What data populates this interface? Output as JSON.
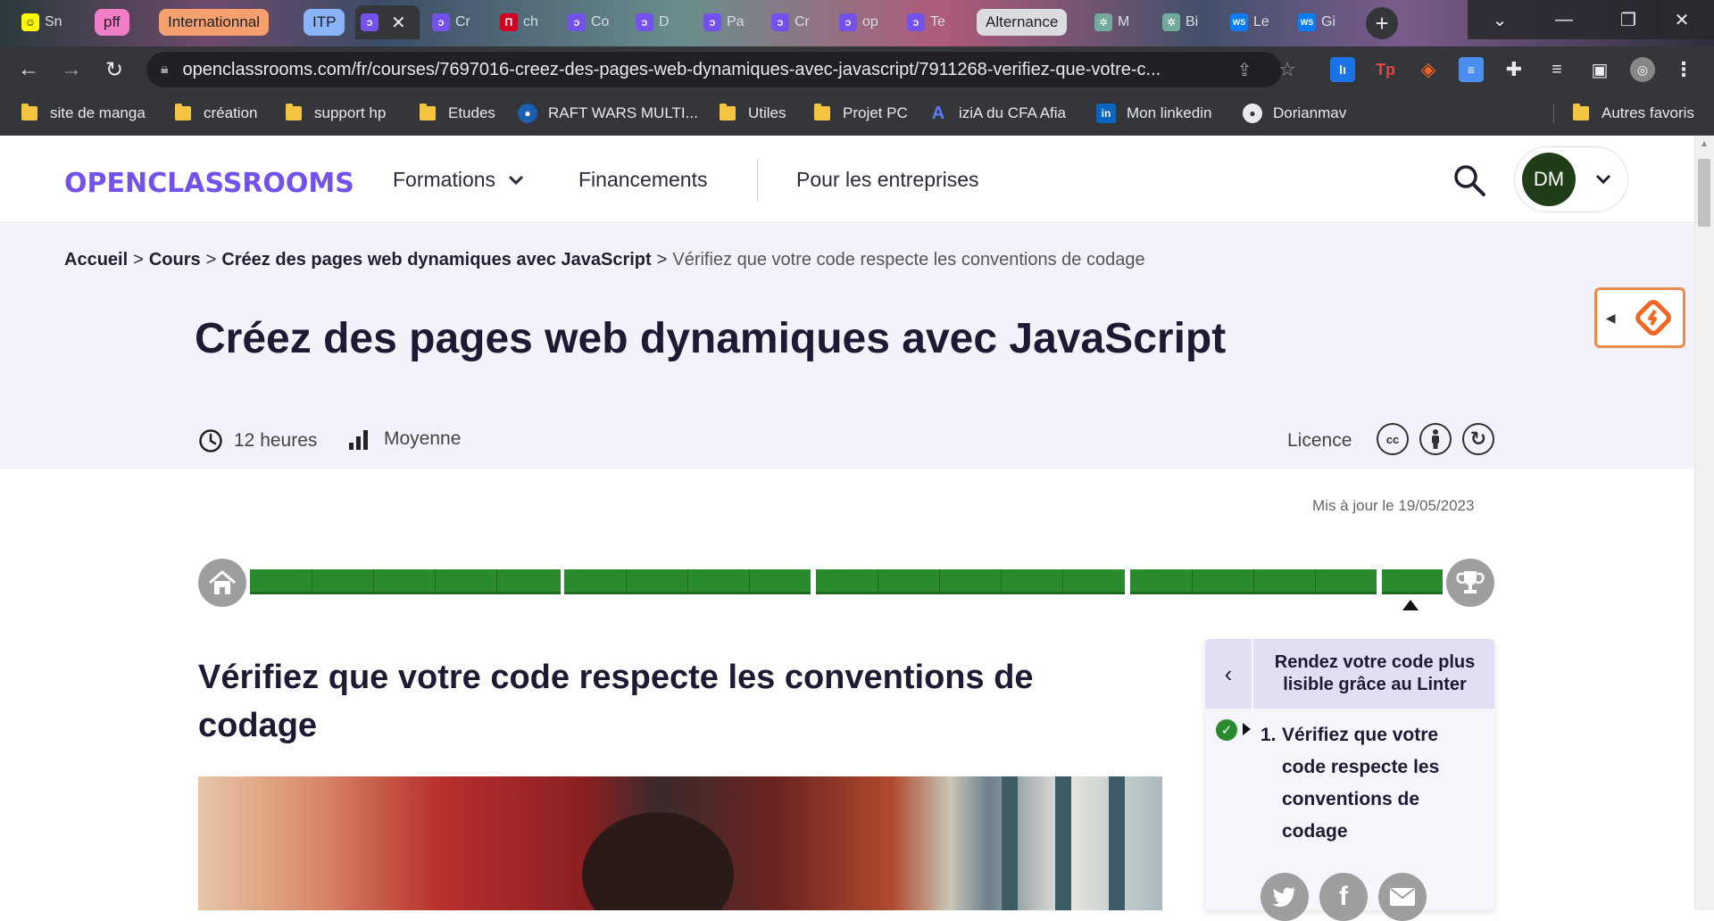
{
  "browser": {
    "tabs": [
      {
        "label": "Sn",
        "icon": "snapchat-icon",
        "color": "#fffc00"
      },
      {
        "label": "",
        "group": "pff",
        "group_color": "#f07fc8"
      },
      {
        "label": "",
        "group": "Internationnal",
        "group_color": "#f5a06e"
      },
      {
        "label": "",
        "group": "ITP",
        "group_color": "#8ab4f8"
      },
      {
        "label": "",
        "icon": "openclassrooms-icon",
        "active": true
      },
      {
        "label": "Cr",
        "icon": "openclassrooms-icon"
      },
      {
        "label": "ch",
        "icon": "red-app-icon"
      },
      {
        "label": "Co",
        "icon": "openclassrooms-icon"
      },
      {
        "label": "D",
        "icon": "openclassrooms-icon"
      },
      {
        "label": "Pa",
        "icon": "openclassrooms-icon"
      },
      {
        "label": "Cr",
        "icon": "openclassrooms-icon"
      },
      {
        "label": "op",
        "icon": "openclassrooms-icon"
      },
      {
        "label": "Te",
        "icon": "openclassrooms-icon"
      },
      {
        "label": "",
        "group": "Alternance",
        "group_color": "#dadce0"
      },
      {
        "label": "M",
        "icon": "chatgpt-icon"
      },
      {
        "label": "Bi",
        "icon": "chatgpt-icon"
      },
      {
        "label": "Le",
        "icon": "webstorm-icon"
      },
      {
        "label": "Gi",
        "icon": "webstorm-icon"
      }
    ],
    "tab_group_labels": {
      "pff": "pff",
      "internationnal": "Internationnal",
      "itp": "ITP",
      "alternance": "Alternance"
    },
    "url": "openclassrooms.com/fr/courses/7697016-creez-des-pages-web-dynamiques-avec-javascript/7911268-verifiez-que-votre-c...",
    "bookmarks": [
      "site de manga",
      "création",
      "support hp",
      "Etudes",
      "RAFT WARS MULTI...",
      "Utiles",
      "Projet PC",
      "iziA du CFA Afia",
      "Mon linkedin",
      "Dorianmav"
    ],
    "other_bookmarks": "Autres favoris"
  },
  "site": {
    "logo": "OPENCLASSROOMS",
    "nav": {
      "formations": "Formations",
      "financements": "Financements",
      "entreprises": "Pour les entreprises"
    },
    "user_initials": "DM",
    "colors": {
      "brand": "#7451eb",
      "progress": "#2a8a2e",
      "avatar": "#1f3d18"
    }
  },
  "breadcrumb": {
    "home": "Accueil",
    "courses": "Cours",
    "course": "Créez des pages web dynamiques avec JavaScript",
    "current": "Vérifiez que votre code respecte les conventions de codage",
    "sep": ">"
  },
  "course": {
    "title": "Créez des pages web dynamiques avec JavaScript",
    "duration": "12 heures",
    "level": "Moyenne",
    "license_label": "Licence",
    "updated": "Mis à jour le 19/05/2023"
  },
  "chapter": {
    "title": "Vérifiez que votre code respecte les conventions de codage"
  },
  "sidebar": {
    "part_title": "Rendez votre code plus lisible grâce au Linter",
    "item_number": "1.",
    "item_title": "Vérifiez que votre code respecte les conventions de codage"
  }
}
